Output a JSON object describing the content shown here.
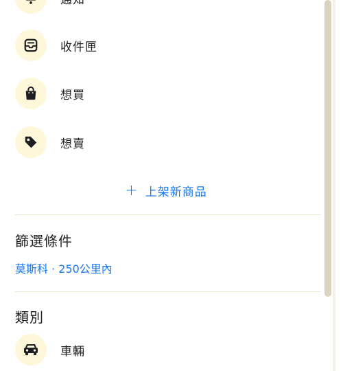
{
  "nav": {
    "items": [
      {
        "label": "通知",
        "icon": "bell-icon"
      },
      {
        "label": "收件匣",
        "icon": "inbox-icon"
      },
      {
        "label": "想買",
        "icon": "shopping-bag-icon"
      },
      {
        "label": "想賣",
        "icon": "price-tag-icon"
      }
    ]
  },
  "add_listing": {
    "plus": "+",
    "label": "上架新商品"
  },
  "filters": {
    "title": "篩選條件",
    "location": "莫斯科 · 250公里內"
  },
  "categories": {
    "title": "類別",
    "items": [
      {
        "label": "車輛",
        "icon": "car-icon"
      }
    ]
  },
  "colors": {
    "accent": "#1877f2",
    "icon_bg": "#fff7d9",
    "divider": "#efe8d2",
    "scrollbar": "#dcd2bd"
  }
}
